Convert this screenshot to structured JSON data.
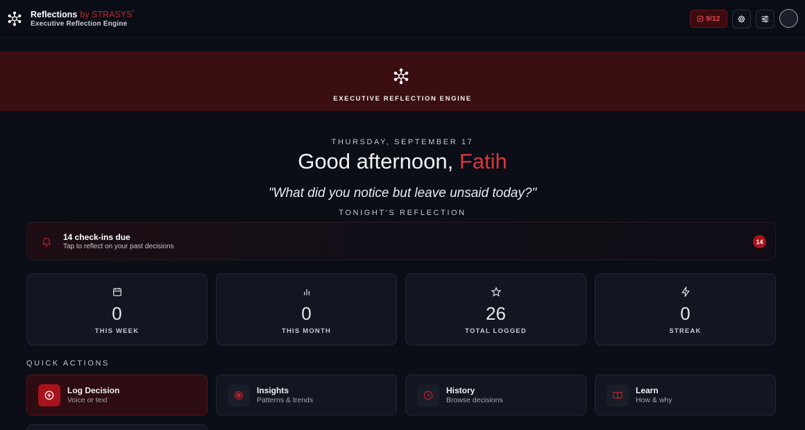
{
  "app": {
    "title": "Reflections",
    "by": "by STRASYS",
    "trademark": "°",
    "subtitle": "Executive Reflection Engine"
  },
  "header": {
    "quota": "9/12",
    "icons": [
      "checklist-icon",
      "gear-icon",
      "sliders-icon"
    ]
  },
  "hero": {
    "title": "EXECUTIVE REFLECTION ENGINE"
  },
  "greeting": {
    "date": "THURSDAY, SEPTEMBER 17",
    "prefix": "Good afternoon, ",
    "name": "Fatih",
    "quote": "\"What did you notice but leave unsaid today?\"",
    "section": "TONIGHT'S REFLECTION"
  },
  "checkins": {
    "title": "14 check-ins due",
    "subtitle": "Tap to reflect on your past decisions",
    "count": "14"
  },
  "stats": [
    {
      "icon": "calendar-icon",
      "value": "0",
      "label": "THIS WEEK"
    },
    {
      "icon": "bar-chart-icon",
      "value": "0",
      "label": "THIS MONTH"
    },
    {
      "icon": "star-icon",
      "value": "26",
      "label": "TOTAL LOGGED"
    },
    {
      "icon": "lightning-icon",
      "value": "0",
      "label": "STREAK"
    }
  ],
  "quick_actions": {
    "label": "QUICK ACTIONS",
    "items": [
      {
        "icon": "plus-circle-icon",
        "title": "Log Decision",
        "subtitle": "Voice or text"
      },
      {
        "icon": "target-icon",
        "title": "Insights",
        "subtitle": "Patterns & trends"
      },
      {
        "icon": "clock-icon",
        "title": "History",
        "subtitle": "Browse decisions"
      },
      {
        "icon": "book-icon",
        "title": "Learn",
        "subtitle": "How & why"
      }
    ]
  },
  "colors": {
    "background": "#0b0e16",
    "accent": "#c0262d",
    "banner": "#3b0e12",
    "card": "#121621"
  }
}
